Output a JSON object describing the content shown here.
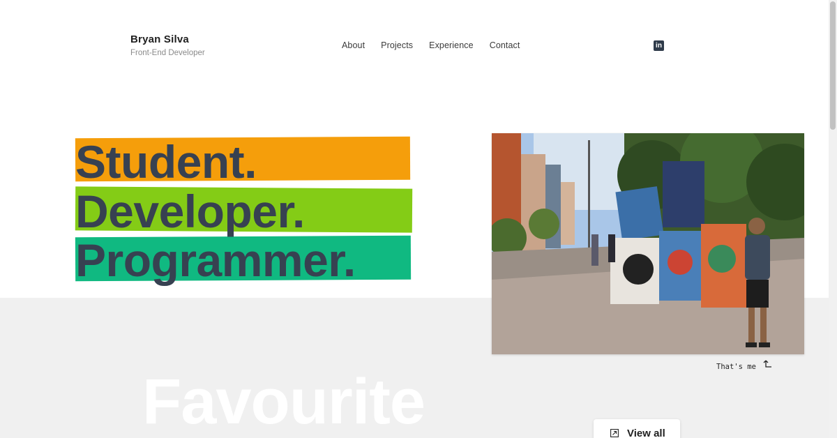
{
  "header": {
    "name": "Bryan Silva",
    "role": "Front-End Developer",
    "nav": [
      "About",
      "Projects",
      "Experience",
      "Contact"
    ],
    "social_icon": "linkedin-icon",
    "theme_icon": "moon-icon",
    "social_label": "in"
  },
  "hero": {
    "lines": [
      "Student.",
      "Developer.",
      "Programmer."
    ],
    "band_colors": [
      "#f59e0b",
      "#84cc16",
      "#10b981"
    ],
    "text_color": "#374151"
  },
  "photo": {
    "caption": "That's me",
    "caption_icon": "arrow-up-left-icon"
  },
  "section": {
    "title": "Favourite",
    "view_all_label": "View all",
    "view_all_icon": "external-link-icon"
  }
}
